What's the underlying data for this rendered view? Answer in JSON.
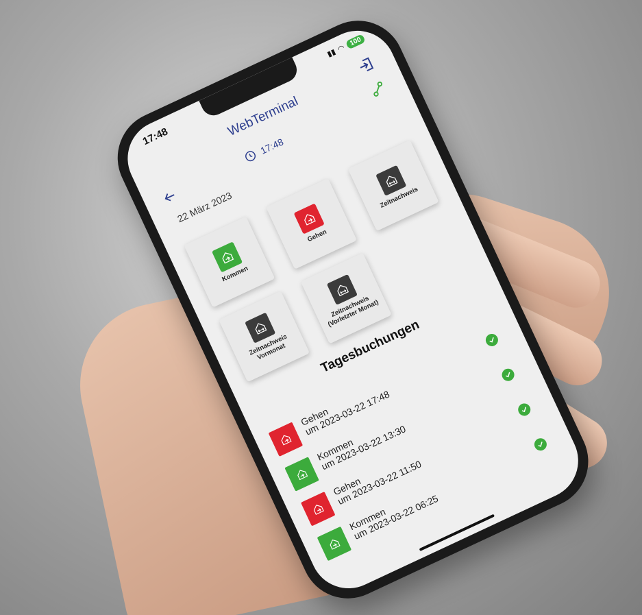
{
  "status": {
    "time": "17:48",
    "battery": "100"
  },
  "app": {
    "title": "WebTerminal"
  },
  "header": {
    "clock_time": "17:48",
    "date": "22 März 2023"
  },
  "tiles": [
    {
      "label": "Kommen",
      "color": "#3cab3c",
      "icon": "enter-house-icon"
    },
    {
      "label": "Gehen",
      "color": "#e0242f",
      "icon": "exit-house-icon"
    },
    {
      "label": "Zeitnachweis",
      "color": "#3b3b3b",
      "icon": "time-record-icon"
    },
    {
      "label": "Zeitnachweis (Vorletzter Monat)",
      "color": "#3b3b3b",
      "icon": "time-record-icon"
    },
    {
      "label": "Zeitnachweis Vormonat",
      "color": "#3b3b3b",
      "icon": "time-record-icon"
    }
  ],
  "bookings_section": {
    "title": "Tagesbuchungen"
  },
  "bookings": [
    {
      "type": "Gehen",
      "when": "um 2023-03-22 17:48",
      "color": "#e0242f"
    },
    {
      "type": "Kommen",
      "when": "um 2023-03-22 13:30",
      "color": "#3cab3c"
    },
    {
      "type": "Gehen",
      "when": "um 2023-03-22 11:50",
      "color": "#e0242f"
    },
    {
      "type": "Kommen",
      "when": "um 2023-03-22 06:25",
      "color": "#3cab3c"
    }
  ]
}
